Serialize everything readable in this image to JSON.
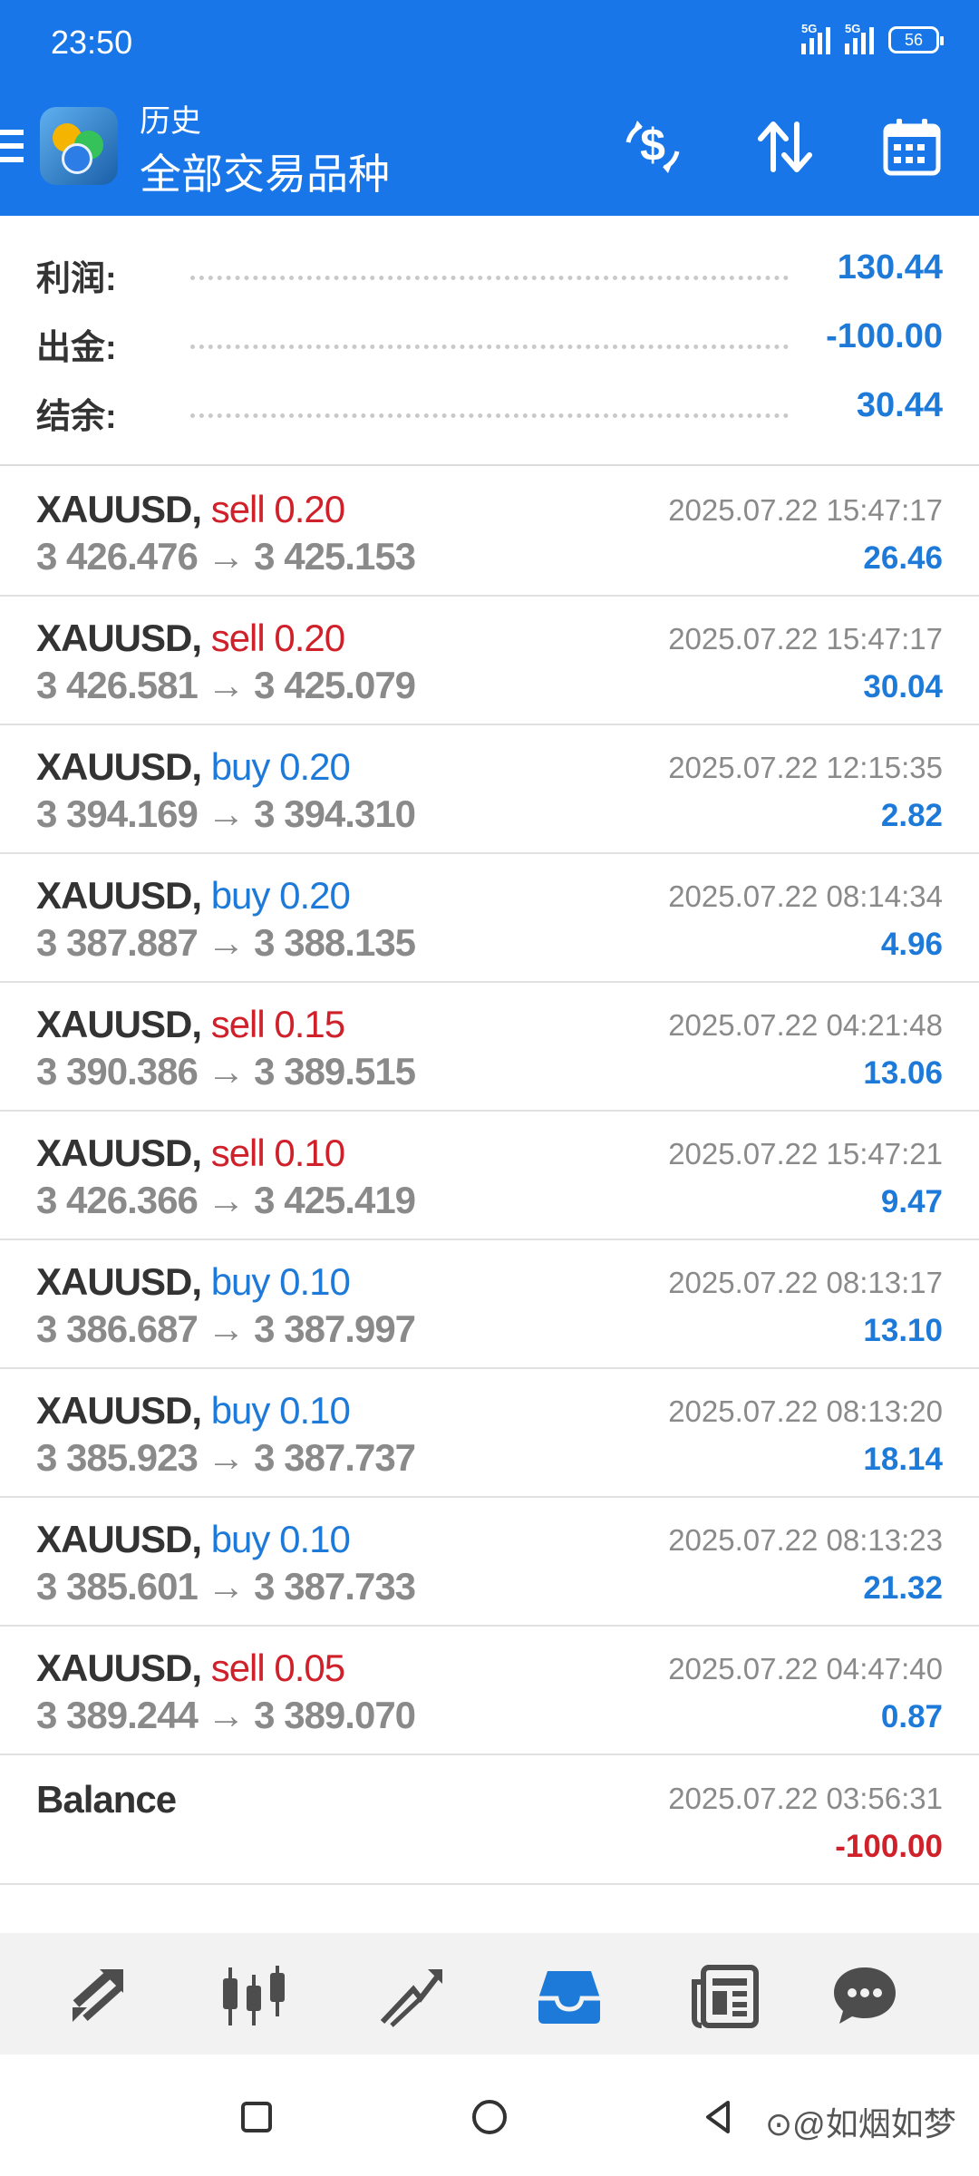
{
  "status_bar": {
    "time": "23:50",
    "network_1": "5G",
    "network_2": "5G",
    "battery": "56"
  },
  "header": {
    "menu_icon": "hamburger-icon",
    "app_icon": "metatrader-logo",
    "subtitle": "历史",
    "title": "全部交易品种",
    "actions": [
      "dollar-swap-icon",
      "sort-icon",
      "calendar-icon"
    ]
  },
  "summary": [
    {
      "label": "利润:",
      "value": "130.44"
    },
    {
      "label": "出金:",
      "value": "-100.00"
    },
    {
      "label": "结余:",
      "value": "30.44"
    }
  ],
  "trades": [
    {
      "symbol": "XAUUSD,",
      "side": "sell",
      "side_text": "sell 0.20",
      "prices": "3 426.476 → 3 425.153",
      "time": "2025.07.22 15:47:17",
      "profit": "26.46"
    },
    {
      "symbol": "XAUUSD,",
      "side": "sell",
      "side_text": "sell 0.20",
      "prices": "3 426.581 → 3 425.079",
      "time": "2025.07.22 15:47:17",
      "profit": "30.04"
    },
    {
      "symbol": "XAUUSD,",
      "side": "buy",
      "side_text": "buy 0.20",
      "prices": "3 394.169 → 3 394.310",
      "time": "2025.07.22 12:15:35",
      "profit": "2.82"
    },
    {
      "symbol": "XAUUSD,",
      "side": "buy",
      "side_text": "buy 0.20",
      "prices": "3 387.887 → 3 388.135",
      "time": "2025.07.22 08:14:34",
      "profit": "4.96"
    },
    {
      "symbol": "XAUUSD,",
      "side": "sell",
      "side_text": "sell 0.15",
      "prices": "3 390.386 → 3 389.515",
      "time": "2025.07.22 04:21:48",
      "profit": "13.06"
    },
    {
      "symbol": "XAUUSD,",
      "side": "sell",
      "side_text": "sell 0.10",
      "prices": "3 426.366 → 3 425.419",
      "time": "2025.07.22 15:47:21",
      "profit": "9.47"
    },
    {
      "symbol": "XAUUSD,",
      "side": "buy",
      "side_text": "buy 0.10",
      "prices": "3 386.687 → 3 387.997",
      "time": "2025.07.22 08:13:17",
      "profit": "13.10"
    },
    {
      "symbol": "XAUUSD,",
      "side": "buy",
      "side_text": "buy 0.10",
      "prices": "3 385.923 → 3 387.737",
      "time": "2025.07.22 08:13:20",
      "profit": "18.14"
    },
    {
      "symbol": "XAUUSD,",
      "side": "buy",
      "side_text": "buy 0.10",
      "prices": "3 385.601 → 3 387.733",
      "time": "2025.07.22 08:13:23",
      "profit": "21.32"
    },
    {
      "symbol": "XAUUSD,",
      "side": "sell",
      "side_text": "sell 0.05",
      "prices": "3 389.244 → 3 389.070",
      "time": "2025.07.22 04:47:40",
      "profit": "0.87"
    }
  ],
  "balance": {
    "label": "Balance",
    "time": "2025.07.22 03:56:31",
    "value": "-100.00"
  },
  "bottom_nav": [
    "quotes-icon",
    "chart-icon",
    "trade-icon",
    "history-icon",
    "news-icon",
    "chat-icon"
  ],
  "active_nav": "history-icon",
  "system_nav": [
    "recents-icon",
    "home-icon",
    "back-icon"
  ],
  "watermark": "⊙@如烟如梦",
  "colors": {
    "header_bg": "#1976e8",
    "positive": "#1e7ad8",
    "negative": "#d0202a",
    "secondary_text": "#8a8a8a"
  }
}
